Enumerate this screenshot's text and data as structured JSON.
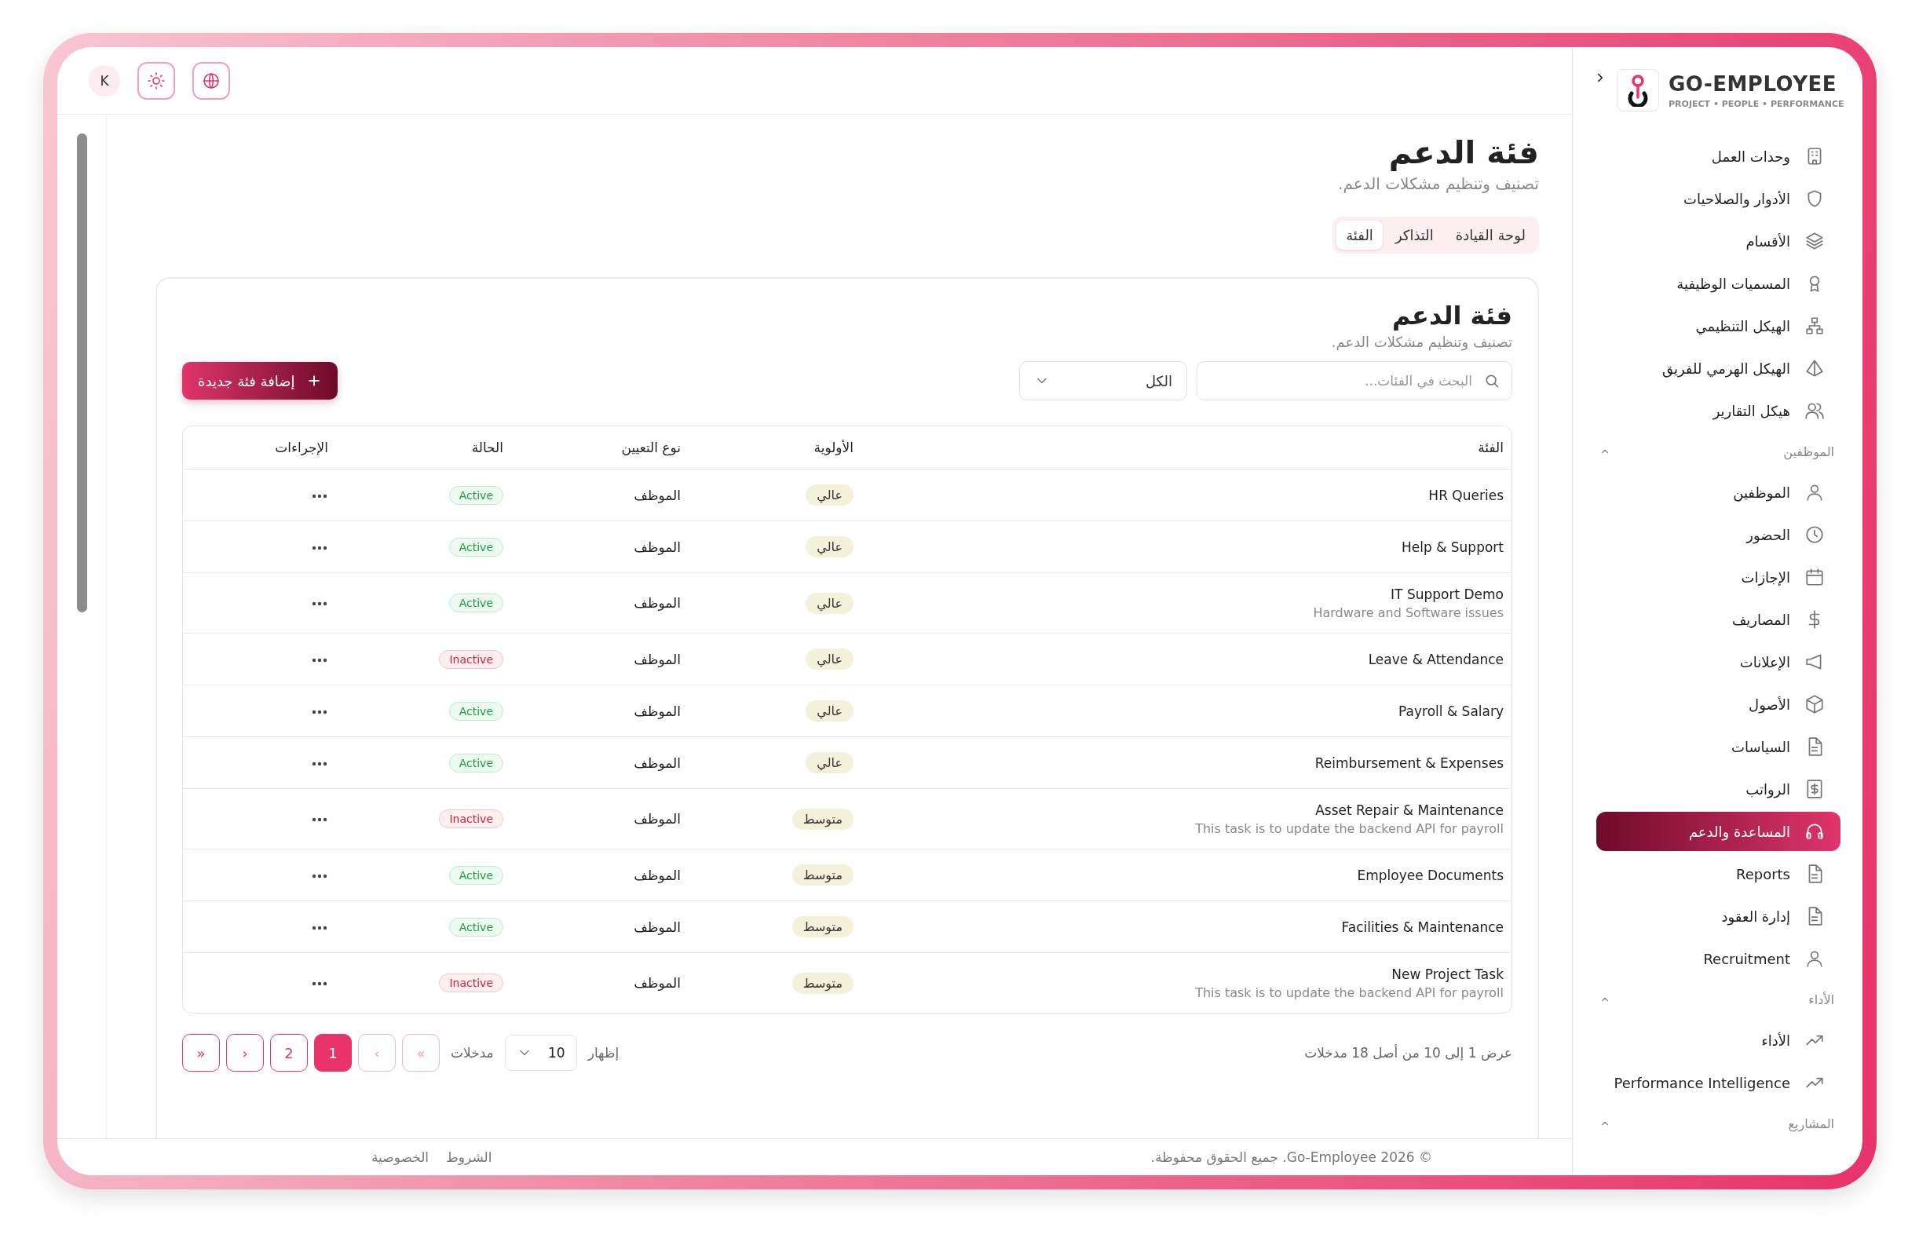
{
  "topbar": {
    "avatar": "K"
  },
  "sidebar": {
    "brand": {
      "name": "GO-EMPLOYEE",
      "tagline": "PROJECT • PEOPLE • PERFORMANCE"
    },
    "sections": [
      {
        "items": [
          {
            "label": "وحدات العمل",
            "selected": false
          },
          {
            "label": "الأدوار والصلاحيات",
            "selected": false
          },
          {
            "label": "الأقسام",
            "selected": false
          },
          {
            "label": "المسميات الوظيفية",
            "selected": false
          },
          {
            "label": "الهيكل التنظيمي",
            "selected": false
          },
          {
            "label": "الهيكل الهرمي للفريق",
            "selected": false
          },
          {
            "label": "هيكل التقارير",
            "selected": false
          }
        ]
      },
      {
        "title": "الموظفين",
        "expanded": true,
        "items": [
          {
            "label": "الموظفين",
            "selected": false
          },
          {
            "label": "الحضور",
            "selected": false
          },
          {
            "label": "الإجازات",
            "selected": false
          },
          {
            "label": "المصاريف",
            "selected": false
          },
          {
            "label": "الإعلانات",
            "selected": false
          },
          {
            "label": "الأصول",
            "selected": false
          },
          {
            "label": "السياسات",
            "selected": false
          },
          {
            "label": "الرواتب",
            "selected": false
          },
          {
            "label": "المساعدة والدعم",
            "selected": true
          },
          {
            "label": "Reports",
            "selected": false
          },
          {
            "label": "إدارة العقود",
            "selected": false
          },
          {
            "label": "Recruitment",
            "selected": false
          }
        ]
      },
      {
        "title": "الأداء",
        "expanded": true,
        "items": [
          {
            "label": "الأداء",
            "selected": false
          },
          {
            "label": "Performance Intelligence",
            "selected": false
          }
        ]
      },
      {
        "title": "المشاريع",
        "expanded": true
      }
    ]
  },
  "page": {
    "title": "فئة الدعم",
    "subtitle": "تصنيف وتنظيم مشكلات الدعم.",
    "tabs": [
      {
        "label": "لوحة القيادة",
        "selected": false
      },
      {
        "label": "التذاكر",
        "selected": false
      },
      {
        "label": "الفئة",
        "selected": true
      }
    ]
  },
  "card": {
    "title": "فئة الدعم",
    "subtitle": "تصنيف وتنظيم مشكلات الدعم.",
    "search": {
      "placeholder": "البحث في الفئات..."
    },
    "filter": {
      "value": "الكل"
    },
    "add_button": "إضافة فئة جديدة",
    "table": {
      "columns": [
        "الفئة",
        "الأولوية",
        "نوع التعيين",
        "الحالة",
        "الإجراءات"
      ],
      "rows": [
        {
          "name": "HR Queries",
          "priority": "عالي",
          "assignment": "الموظف",
          "status": {
            "label": "Active",
            "active": true
          }
        },
        {
          "name": "Help & Support",
          "priority": "عالي",
          "assignment": "الموظف",
          "status": {
            "label": "Active",
            "active": true
          }
        },
        {
          "name": "IT Support Demo",
          "description": "Hardware and Software issues",
          "priority": "عالي",
          "assignment": "الموظف",
          "status": {
            "label": "Active",
            "active": true
          }
        },
        {
          "name": "Leave & Attendance",
          "priority": "عالي",
          "assignment": "الموظف",
          "status": {
            "label": "Inactive",
            "active": false
          }
        },
        {
          "name": "Payroll & Salary",
          "priority": "عالي",
          "assignment": "الموظف",
          "status": {
            "label": "Active",
            "active": true
          }
        },
        {
          "name": "Reimbursement & Expenses",
          "priority": "عالي",
          "assignment": "الموظف",
          "status": {
            "label": "Active",
            "active": true
          }
        },
        {
          "name": "Asset Repair & Maintenance",
          "description": "This task is to update the backend API for payroll",
          "priority": "متوسط",
          "assignment": "الموظف",
          "status": {
            "label": "Inactive",
            "active": false
          }
        },
        {
          "name": "Employee Documents",
          "priority": "متوسط",
          "assignment": "الموظف",
          "status": {
            "label": "Active",
            "active": true
          }
        },
        {
          "name": "Facilities & Maintenance",
          "priority": "متوسط",
          "assignment": "الموظف",
          "status": {
            "label": "Active",
            "active": true
          }
        },
        {
          "name": "New Project Task",
          "description": "This task is to update the backend API for payroll",
          "priority": "متوسط",
          "assignment": "الموظف",
          "status": {
            "label": "Inactive",
            "active": false
          }
        }
      ]
    },
    "pagination": {
      "summary": "عرض 1 إلى 10 من أصل 18 مدخلات",
      "show_label": "إظهار",
      "page_size": "10",
      "entries_label": "مدخلات",
      "buttons": [
        {
          "label": "«",
          "selected": false,
          "disabled": true
        },
        {
          "label": "‹",
          "selected": false,
          "disabled": true
        },
        {
          "label": "1",
          "selected": true,
          "disabled": false
        },
        {
          "label": "2",
          "selected": false,
          "disabled": false
        },
        {
          "label": "›",
          "selected": false,
          "disabled": false
        },
        {
          "label": "»",
          "selected": false,
          "disabled": false
        }
      ]
    }
  },
  "footer": {
    "copyright": "© Go-Employee 2026. جميع الحقوق محفوظة.",
    "links": [
      "الشروط",
      "الخصوصية"
    ]
  }
}
